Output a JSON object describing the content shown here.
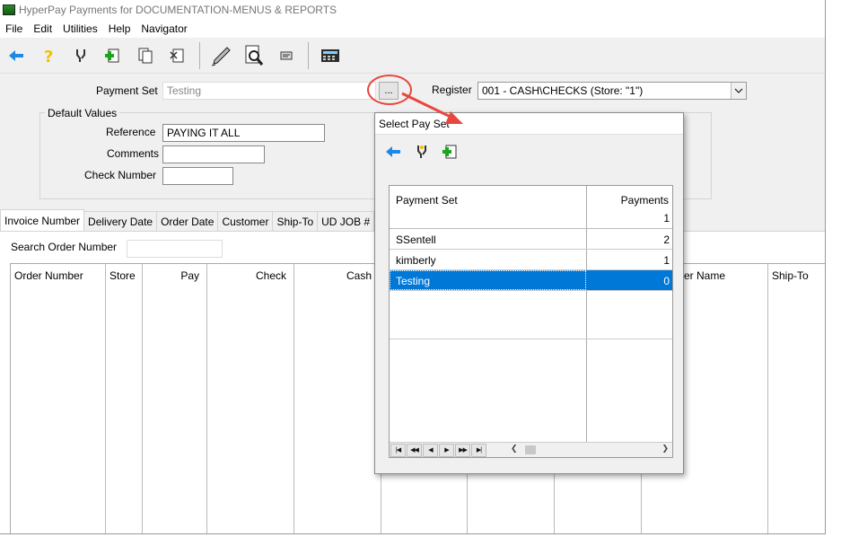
{
  "window": {
    "title": "HyperPay Payments for DOCUMENTATION-MENUS & REPORTS"
  },
  "menu": [
    "File",
    "Edit",
    "Utilities",
    "Help",
    "Navigator"
  ],
  "toolbar": {
    "icons": [
      "back-arrow-icon",
      "help-icon",
      "wrench-icon",
      "add-icon",
      "copy-icon",
      "delete-icon",
      "pen-icon",
      "preview-icon",
      "card-icon",
      "calculator-icon"
    ]
  },
  "form": {
    "payment_set_label": "Payment Set",
    "payment_set_value": "Testing",
    "browse_label": "...",
    "register_label": "Register",
    "register_value": "001 - CASH\\CHECKS (Store: \"1\")",
    "default_values_label": "Default Values",
    "reference_label": "Reference",
    "reference_value": "PAYING IT ALL",
    "comments_label": "Comments",
    "comments_value": "",
    "check_number_label": "Check Number",
    "check_number_value": ""
  },
  "tabs": [
    "Invoice Number",
    "Delivery Date",
    "Order Date",
    "Customer",
    "Ship-To",
    "UD JOB #"
  ],
  "search": {
    "label": "Search Order Number",
    "value": ""
  },
  "grid": {
    "columns": [
      "Order Number",
      "Store",
      "Pay",
      "Check",
      "Cash",
      "er Name",
      "Ship-To"
    ]
  },
  "dialog": {
    "title": "Select Pay Set",
    "columns": [
      "Payment Set",
      "Payments"
    ],
    "rows": [
      {
        "name": "",
        "payments": "1"
      },
      {
        "name": "SSentell",
        "payments": "2"
      },
      {
        "name": "kimberly",
        "payments": "1"
      },
      {
        "name": "Testing",
        "payments": "0"
      }
    ],
    "selected_row": 3
  },
  "colors": {
    "selection": "#0078d7",
    "annotation": "#e8473f",
    "accent_blue": "#1e88e5"
  }
}
